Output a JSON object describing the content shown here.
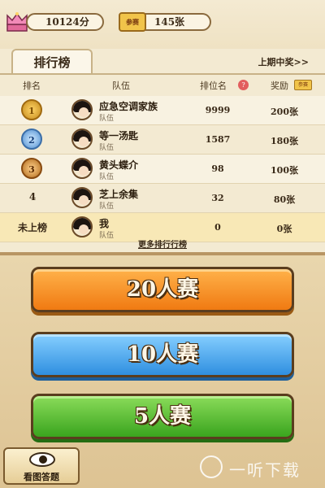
{
  "header": {
    "score": "10124分",
    "ticket_badge": "参赛",
    "tickets": "145张"
  },
  "leaderboard": {
    "tab_label": "排行榜",
    "last_winner_link": "上期中奖>>",
    "columns": {
      "rank": "排名",
      "team": "队伍",
      "position": "排位名",
      "reward": "奖励",
      "reward_badge": "参赛"
    },
    "rows": [
      {
        "rank": "1",
        "name": "应急空调家族",
        "sub": "队伍",
        "position": "9999",
        "reward": "200张"
      },
      {
        "rank": "2",
        "name": "等一汤匙",
        "sub": "队伍",
        "position": "1587",
        "reward": "180张"
      },
      {
        "rank": "3",
        "name": "黄头蝶介",
        "sub": "队伍",
        "position": "98",
        "reward": "100张"
      },
      {
        "rank": "4",
        "name": "芝上余集",
        "sub": "队伍",
        "position": "32",
        "reward": "80张"
      },
      {
        "rank": "未上榜",
        "name": "我",
        "sub": "队伍",
        "position": "0",
        "reward": "0张"
      }
    ],
    "more_link": "更多排行行榜"
  },
  "modes": {
    "twenty": "20人赛",
    "ten": "10人赛",
    "five": "5人赛"
  },
  "bottom": {
    "picture_quiz": "看图答题"
  },
  "watermark": "一听下载"
}
